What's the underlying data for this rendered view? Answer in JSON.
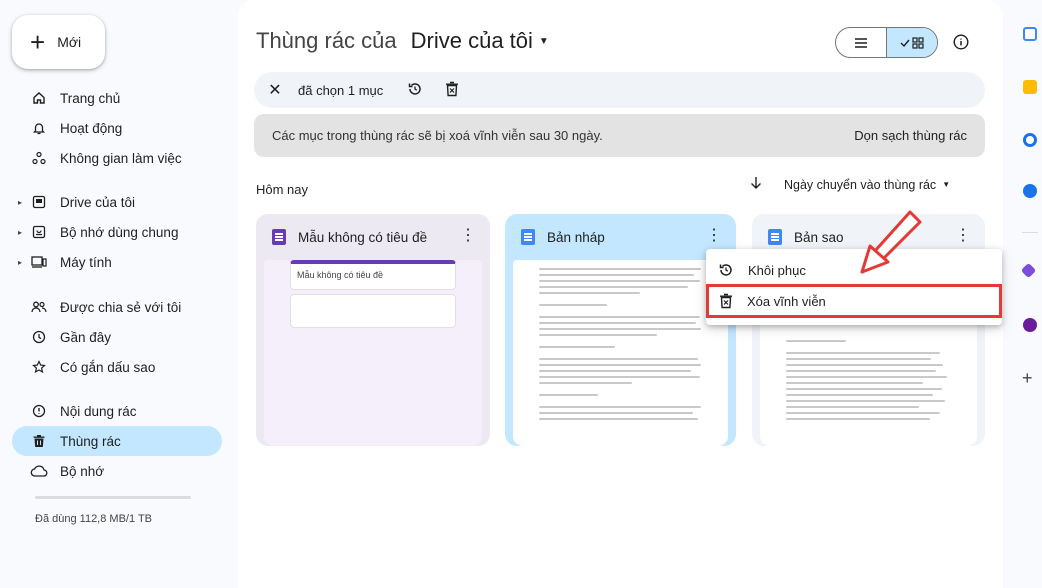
{
  "sidebar": {
    "new_label": "Mới",
    "items": [
      {
        "label": "Trang chủ",
        "icon": "home-icon"
      },
      {
        "label": "Hoạt động",
        "icon": "bell-icon"
      },
      {
        "label": "Không gian làm việc",
        "icon": "workspace-icon"
      },
      {
        "label": "Drive của tôi",
        "icon": "drive-icon"
      },
      {
        "label": "Bộ nhớ dùng chung",
        "icon": "shared-drive-icon"
      },
      {
        "label": "Máy tính",
        "icon": "computer-icon"
      },
      {
        "label": "Được chia sẻ với tôi",
        "icon": "shared-icon"
      },
      {
        "label": "Gần đây",
        "icon": "clock-icon"
      },
      {
        "label": "Có gắn dấu sao",
        "icon": "star-icon"
      },
      {
        "label": "Nội dung rác",
        "icon": "spam-icon"
      },
      {
        "label": "Thùng rác",
        "icon": "trash-icon"
      },
      {
        "label": "Bộ nhớ",
        "icon": "cloud-icon"
      }
    ],
    "storage_text": "Đã dùng 112,8 MB/1 TB"
  },
  "header": {
    "title_prefix": "Thùng rác của",
    "title_location": "Drive của tôi"
  },
  "selection_bar": {
    "count_label": "đã chọn 1 mục"
  },
  "banner": {
    "message": "Các mục trong thùng rác sẽ bị xoá vĩnh viễn sau 30 ngày.",
    "action": "Dọn sạch thùng rác"
  },
  "list": {
    "section": "Hôm nay",
    "sort_label": "Ngày chuyển vào thùng rác"
  },
  "files": [
    {
      "name": "Mẫu không có tiêu đề",
      "type": "forms",
      "preview_title": "Mẫu không có tiêu đề"
    },
    {
      "name": "Bản nháp",
      "type": "docs"
    },
    {
      "name": "Bản sao",
      "type": "docs"
    }
  ],
  "context_menu": {
    "items": [
      {
        "label": "Khôi phục",
        "icon": "restore-icon"
      },
      {
        "label": "Xóa vĩnh viễn",
        "icon": "delete-forever-icon"
      }
    ]
  },
  "colors": {
    "active_nav": "#c2e7ff",
    "highlight_box": "#e53935",
    "forms_purple": "#673ab7",
    "docs_blue": "#4285f4"
  }
}
